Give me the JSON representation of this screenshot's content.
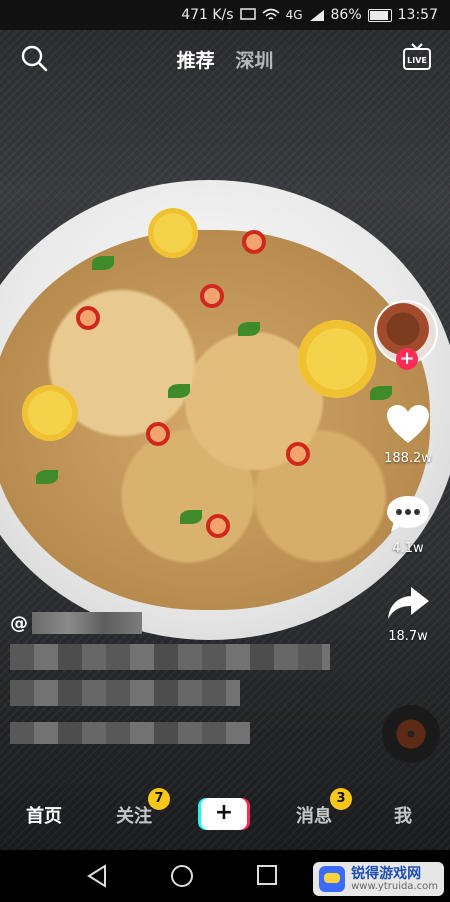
{
  "status_bar": {
    "speed": "471 K/s",
    "network": "4G",
    "battery": "86%",
    "time": "13:57"
  },
  "top_bar": {
    "tab_recommend": "推荐",
    "tab_city": "深圳"
  },
  "actions": {
    "likes": "188.2w",
    "comments": "4.1w",
    "shares": "18.7w"
  },
  "caption": {
    "handle_prefix": "@"
  },
  "bottom_nav": {
    "home": "首页",
    "follow": "关注",
    "follow_badge": "7",
    "create": "+",
    "messages": "消息",
    "messages_badge": "3",
    "me": "我"
  },
  "watermark": {
    "title": "锐得游戏网",
    "url": "www.ytruida.com"
  },
  "icons": {
    "search": "search-icon",
    "live": "live-tv-icon",
    "like": "heart-icon",
    "comment": "comment-icon",
    "share": "share-arrow-icon",
    "back": "back-triangle-icon",
    "home": "home-circle-icon",
    "recents": "recents-square-icon"
  }
}
